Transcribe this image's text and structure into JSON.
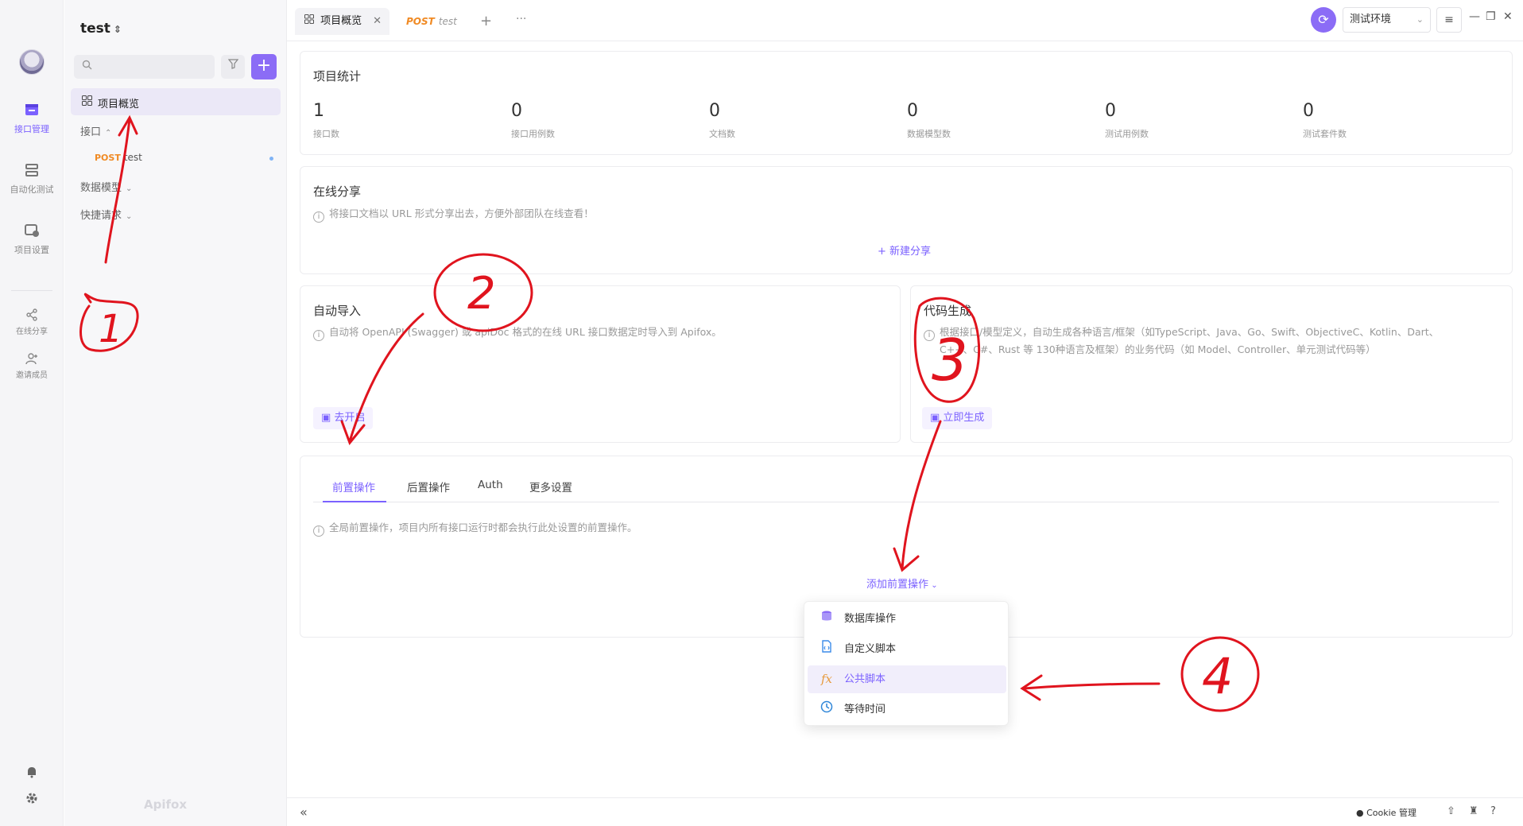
{
  "rail": {
    "items": [
      {
        "label": "接口管理",
        "icon": "api-management-icon"
      },
      {
        "label": "自动化测试",
        "icon": "automation-test-icon"
      },
      {
        "label": "项目设置",
        "icon": "project-settings-icon"
      },
      {
        "label": "在线分享",
        "icon": "share-icon"
      },
      {
        "label": "邀请成员",
        "icon": "invite-member-icon"
      }
    ]
  },
  "sidebar": {
    "project_name": "test",
    "search_placeholder": "",
    "active_item": "项目概览",
    "tree": {
      "api_folder": "接口",
      "api_leaf_method": "POST",
      "api_leaf_name": "test",
      "data_models": "数据模型",
      "quick_requests": "快捷请求"
    },
    "brand": "Apifox"
  },
  "tabs": {
    "active_label": "项目概览",
    "second_method": "POST",
    "second_label": "test"
  },
  "toolbar": {
    "environment": "测试环境"
  },
  "stats": {
    "title": "项目统计",
    "items": [
      {
        "value": "1",
        "label": "接口数"
      },
      {
        "value": "0",
        "label": "接口用例数"
      },
      {
        "value": "0",
        "label": "文档数"
      },
      {
        "value": "0",
        "label": "数据模型数"
      },
      {
        "value": "0",
        "label": "测试用例数"
      },
      {
        "value": "0",
        "label": "测试套件数"
      }
    ]
  },
  "share": {
    "title": "在线分享",
    "desc": "将接口文档以 URL 形式分享出去，方便外部团队在线查看！",
    "new_share": "+ 新建分享"
  },
  "auto_import": {
    "title": "自动导入",
    "desc": "自动将 OpenAPI (Swagger) 或 apiDoc 格式的在线 URL 接口数据定时导入到 Apifox。",
    "button": "去开启"
  },
  "codegen": {
    "title": "代码生成",
    "desc_line1": "根据接口/模型定义，自动生成各种语言/框架（如TypeScript、Java、Go、Swift、ObjectiveC、Kotlin、Dart、",
    "desc_line2": "C++、C#、Rust 等 130种语言及框架）的业务代码（如 Model、Controller、单元测试代码等）",
    "button": "立即生成"
  },
  "operations": {
    "tabs": [
      "前置操作",
      "后置操作",
      "Auth",
      "更多设置"
    ],
    "active_tab": "前置操作",
    "desc": "全局前置操作，项目内所有接口运行时都会执行此处设置的前置操作。",
    "add_label": "添加前置操作",
    "dropdown": [
      {
        "label": "数据库操作",
        "icon": "database-icon"
      },
      {
        "label": "自定义脚本",
        "icon": "script-icon"
      },
      {
        "label": "公共脚本",
        "icon": "function-icon"
      },
      {
        "label": "等待时间",
        "icon": "clock-icon"
      }
    ],
    "hovered_index": 2
  },
  "bottombar": {
    "cookie": "Cookie 管理"
  },
  "annotations": [
    "1",
    "2",
    "3",
    "4"
  ],
  "colors": {
    "accent": "#7b61ff",
    "method_post": "#f08a24",
    "annotation_red": "#e0141e"
  }
}
